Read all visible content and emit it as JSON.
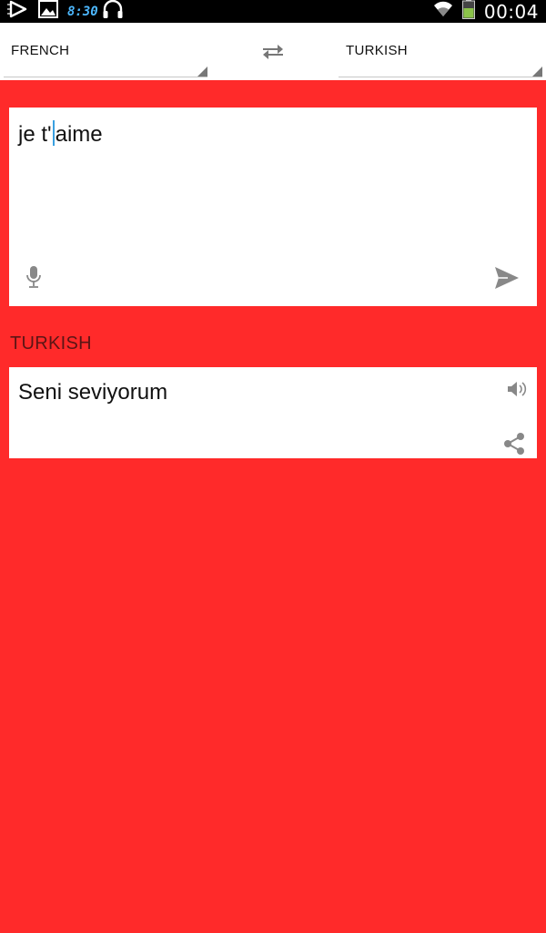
{
  "status_bar": {
    "time": "00:04",
    "clock_widget": "8:30",
    "icons": [
      "play-store-icon",
      "gallery-icon",
      "clock-icon",
      "headphones-icon",
      "wifi-icon",
      "battery-icon"
    ],
    "clock_color": "#4db8ff",
    "battery_color": "#8bc34a"
  },
  "language_bar": {
    "source_language": "FRENCH",
    "target_language": "TURKISH",
    "swap_icon": "swap-arrows-icon"
  },
  "input": {
    "text_before_cursor": "je t'",
    "text_after_cursor": "aime",
    "mic_icon": "microphone-icon",
    "send_icon": "send-icon"
  },
  "result": {
    "language_label": "TURKISH",
    "text": "Seni seviyorum",
    "speaker_icon": "speaker-icon",
    "share_icon": "share-icon"
  },
  "colors": {
    "background": "#ff2a2a",
    "card": "#ffffff",
    "cursor": "#3aa0e0"
  }
}
